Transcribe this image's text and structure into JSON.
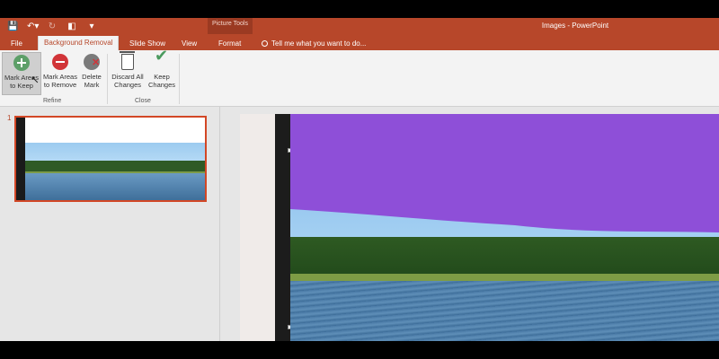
{
  "app": {
    "window_title": "Images - PowerPoint",
    "context_group": "Picture Tools"
  },
  "qat": {
    "save_icon": "save-icon",
    "undo_icon": "undo-icon",
    "redo_icon": "redo-icon",
    "present_icon": "present-icon",
    "customize_icon": "customize-icon"
  },
  "tabs": {
    "file": "File",
    "background_removal": "Background Removal",
    "slide_show": "Slide Show",
    "view": "View",
    "format": "Format",
    "tell_me": "Tell me what you want to do..."
  },
  "ribbon": {
    "mark_keep": {
      "line1": "Mark Areas",
      "line2": "to Keep"
    },
    "mark_remove": {
      "line1": "Mark Areas",
      "line2": "to Remove"
    },
    "delete_mark": {
      "line1": "Delete",
      "line2": "Mark"
    },
    "discard": {
      "line1": "Discard All",
      "line2": "Changes"
    },
    "keep": {
      "line1": "Keep",
      "line2": "Changes"
    },
    "group_refine": "Refine",
    "group_close": "Close"
  },
  "thumbnails": {
    "slide_number": "1"
  },
  "colors": {
    "accent": "#b7472a",
    "removal_overlay": "#8e4fd8"
  }
}
